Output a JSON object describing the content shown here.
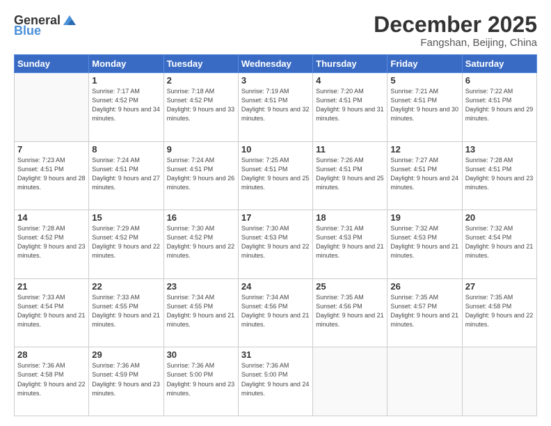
{
  "logo": {
    "general": "General",
    "blue": "Blue"
  },
  "header": {
    "title": "December 2025",
    "subtitle": "Fangshan, Beijing, China"
  },
  "weekdays": [
    "Sunday",
    "Monday",
    "Tuesday",
    "Wednesday",
    "Thursday",
    "Friday",
    "Saturday"
  ],
  "weeks": [
    [
      {
        "day": "",
        "sunrise": "",
        "sunset": "",
        "daylight": "",
        "empty": true
      },
      {
        "day": "1",
        "sunrise": "Sunrise: 7:17 AM",
        "sunset": "Sunset: 4:52 PM",
        "daylight": "Daylight: 9 hours and 34 minutes."
      },
      {
        "day": "2",
        "sunrise": "Sunrise: 7:18 AM",
        "sunset": "Sunset: 4:52 PM",
        "daylight": "Daylight: 9 hours and 33 minutes."
      },
      {
        "day": "3",
        "sunrise": "Sunrise: 7:19 AM",
        "sunset": "Sunset: 4:51 PM",
        "daylight": "Daylight: 9 hours and 32 minutes."
      },
      {
        "day": "4",
        "sunrise": "Sunrise: 7:20 AM",
        "sunset": "Sunset: 4:51 PM",
        "daylight": "Daylight: 9 hours and 31 minutes."
      },
      {
        "day": "5",
        "sunrise": "Sunrise: 7:21 AM",
        "sunset": "Sunset: 4:51 PM",
        "daylight": "Daylight: 9 hours and 30 minutes."
      },
      {
        "day": "6",
        "sunrise": "Sunrise: 7:22 AM",
        "sunset": "Sunset: 4:51 PM",
        "daylight": "Daylight: 9 hours and 29 minutes."
      }
    ],
    [
      {
        "day": "7",
        "sunrise": "Sunrise: 7:23 AM",
        "sunset": "Sunset: 4:51 PM",
        "daylight": "Daylight: 9 hours and 28 minutes."
      },
      {
        "day": "8",
        "sunrise": "Sunrise: 7:24 AM",
        "sunset": "Sunset: 4:51 PM",
        "daylight": "Daylight: 9 hours and 27 minutes."
      },
      {
        "day": "9",
        "sunrise": "Sunrise: 7:24 AM",
        "sunset": "Sunset: 4:51 PM",
        "daylight": "Daylight: 9 hours and 26 minutes."
      },
      {
        "day": "10",
        "sunrise": "Sunrise: 7:25 AM",
        "sunset": "Sunset: 4:51 PM",
        "daylight": "Daylight: 9 hours and 25 minutes."
      },
      {
        "day": "11",
        "sunrise": "Sunrise: 7:26 AM",
        "sunset": "Sunset: 4:51 PM",
        "daylight": "Daylight: 9 hours and 25 minutes."
      },
      {
        "day": "12",
        "sunrise": "Sunrise: 7:27 AM",
        "sunset": "Sunset: 4:51 PM",
        "daylight": "Daylight: 9 hours and 24 minutes."
      },
      {
        "day": "13",
        "sunrise": "Sunrise: 7:28 AM",
        "sunset": "Sunset: 4:51 PM",
        "daylight": "Daylight: 9 hours and 23 minutes."
      }
    ],
    [
      {
        "day": "14",
        "sunrise": "Sunrise: 7:28 AM",
        "sunset": "Sunset: 4:52 PM",
        "daylight": "Daylight: 9 hours and 23 minutes."
      },
      {
        "day": "15",
        "sunrise": "Sunrise: 7:29 AM",
        "sunset": "Sunset: 4:52 PM",
        "daylight": "Daylight: 9 hours and 22 minutes."
      },
      {
        "day": "16",
        "sunrise": "Sunrise: 7:30 AM",
        "sunset": "Sunset: 4:52 PM",
        "daylight": "Daylight: 9 hours and 22 minutes."
      },
      {
        "day": "17",
        "sunrise": "Sunrise: 7:30 AM",
        "sunset": "Sunset: 4:53 PM",
        "daylight": "Daylight: 9 hours and 22 minutes."
      },
      {
        "day": "18",
        "sunrise": "Sunrise: 7:31 AM",
        "sunset": "Sunset: 4:53 PM",
        "daylight": "Daylight: 9 hours and 21 minutes."
      },
      {
        "day": "19",
        "sunrise": "Sunrise: 7:32 AM",
        "sunset": "Sunset: 4:53 PM",
        "daylight": "Daylight: 9 hours and 21 minutes."
      },
      {
        "day": "20",
        "sunrise": "Sunrise: 7:32 AM",
        "sunset": "Sunset: 4:54 PM",
        "daylight": "Daylight: 9 hours and 21 minutes."
      }
    ],
    [
      {
        "day": "21",
        "sunrise": "Sunrise: 7:33 AM",
        "sunset": "Sunset: 4:54 PM",
        "daylight": "Daylight: 9 hours and 21 minutes."
      },
      {
        "day": "22",
        "sunrise": "Sunrise: 7:33 AM",
        "sunset": "Sunset: 4:55 PM",
        "daylight": "Daylight: 9 hours and 21 minutes."
      },
      {
        "day": "23",
        "sunrise": "Sunrise: 7:34 AM",
        "sunset": "Sunset: 4:55 PM",
        "daylight": "Daylight: 9 hours and 21 minutes."
      },
      {
        "day": "24",
        "sunrise": "Sunrise: 7:34 AM",
        "sunset": "Sunset: 4:56 PM",
        "daylight": "Daylight: 9 hours and 21 minutes."
      },
      {
        "day": "25",
        "sunrise": "Sunrise: 7:35 AM",
        "sunset": "Sunset: 4:56 PM",
        "daylight": "Daylight: 9 hours and 21 minutes."
      },
      {
        "day": "26",
        "sunrise": "Sunrise: 7:35 AM",
        "sunset": "Sunset: 4:57 PM",
        "daylight": "Daylight: 9 hours and 21 minutes."
      },
      {
        "day": "27",
        "sunrise": "Sunrise: 7:35 AM",
        "sunset": "Sunset: 4:58 PM",
        "daylight": "Daylight: 9 hours and 22 minutes."
      }
    ],
    [
      {
        "day": "28",
        "sunrise": "Sunrise: 7:36 AM",
        "sunset": "Sunset: 4:58 PM",
        "daylight": "Daylight: 9 hours and 22 minutes."
      },
      {
        "day": "29",
        "sunrise": "Sunrise: 7:36 AM",
        "sunset": "Sunset: 4:59 PM",
        "daylight": "Daylight: 9 hours and 23 minutes."
      },
      {
        "day": "30",
        "sunrise": "Sunrise: 7:36 AM",
        "sunset": "Sunset: 5:00 PM",
        "daylight": "Daylight: 9 hours and 23 minutes."
      },
      {
        "day": "31",
        "sunrise": "Sunrise: 7:36 AM",
        "sunset": "Sunset: 5:00 PM",
        "daylight": "Daylight: 9 hours and 24 minutes."
      },
      {
        "day": "",
        "sunrise": "",
        "sunset": "",
        "daylight": "",
        "empty": true
      },
      {
        "day": "",
        "sunrise": "",
        "sunset": "",
        "daylight": "",
        "empty": true
      },
      {
        "day": "",
        "sunrise": "",
        "sunset": "",
        "daylight": "",
        "empty": true
      }
    ]
  ]
}
